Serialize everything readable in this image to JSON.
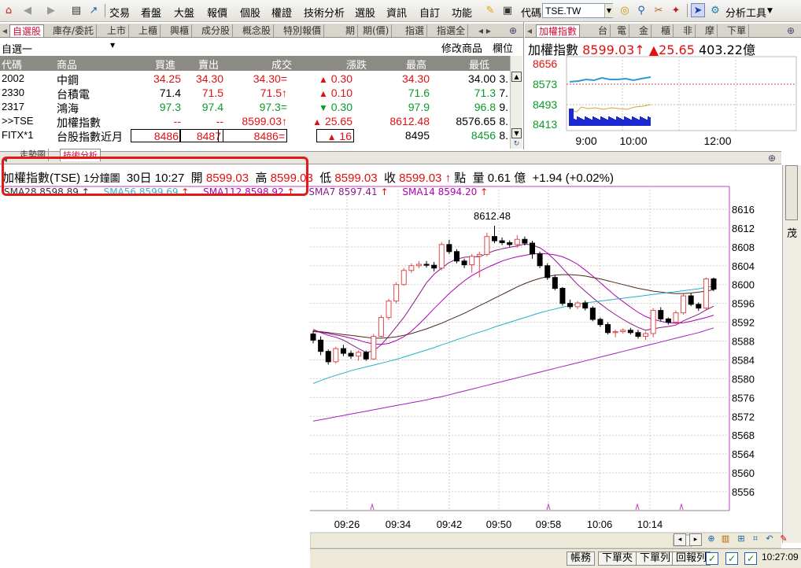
{
  "toolbar": {
    "menus": [
      "交易",
      "看盤",
      "大盤",
      "報價",
      "個股",
      "權證",
      "技術分析",
      "選股",
      "資訊",
      "自訂",
      "功能"
    ],
    "symbol_label": "代碼",
    "symbol_value": "TSE.TW",
    "analysis_tools": "分析工具"
  },
  "quote_panel": {
    "tabs": [
      "自選股",
      "庫存/委託",
      "上市",
      "上櫃",
      "興櫃",
      "成分股",
      "概念股",
      "特別報價",
      "期",
      "期(價)",
      "指選",
      "指選全"
    ],
    "list_name": "自選一",
    "modify_label": "修改商品",
    "field_label": "欄位",
    "headers": [
      "代碼",
      "商品",
      "買進",
      "賣出",
      "成交",
      "漲跌",
      "最高",
      "最低"
    ],
    "rows": [
      {
        "code": "2002",
        "name": "中鋼",
        "bid": "34.25",
        "ask": "34.30",
        "last": "34.30",
        "last_mark": "=",
        "chg_dir": "▲",
        "chg": "0.30",
        "high": "34.30",
        "low": "34.00",
        "tail": "3."
      },
      {
        "code": "2330",
        "name": "台積電",
        "bid": "71.4",
        "ask": "71.5",
        "last": "71.5",
        "last_mark": "↑",
        "chg_dir": "▲",
        "chg": "0.10",
        "high": "71.6",
        "low": "71.3",
        "tail": "7."
      },
      {
        "code": "2317",
        "name": "鴻海",
        "bid": "97.3",
        "ask": "97.4",
        "last": "97.3",
        "last_mark": "=",
        "chg_dir": "▼",
        "chg": "0.30",
        "high": "97.9",
        "low": "96.8",
        "tail": "9."
      },
      {
        "code": ">>TSE",
        "name": "加權指數",
        "bid": "--",
        "ask": "--",
        "last": "8599.03",
        "last_mark": "↑",
        "chg_dir": "▲",
        "chg": "25.65",
        "high": "8612.48",
        "low": "8576.65",
        "tail": "8."
      },
      {
        "code": "FITX*1",
        "name": "台股指數近月",
        "bid": "8486",
        "ask": "8487",
        "last": "8486",
        "last_mark": "=",
        "chg_dir": "▲",
        "chg": "16",
        "high": "8495",
        "low": "8456",
        "tail": "8."
      }
    ]
  },
  "mini_panel": {
    "tabs": [
      "加權指數",
      "台",
      "電",
      "金",
      "櫃",
      "非",
      "摩",
      "下單"
    ],
    "name": "加權指數",
    "price": "8599.03",
    "price_mark": "↑",
    "change": "▲25.65",
    "volume": "403.22億",
    "y_ticks": [
      "8656",
      "8573",
      "8493",
      "8413"
    ],
    "x_ticks": [
      "9:00",
      "10:00",
      "12:00"
    ]
  },
  "chart_panel": {
    "tabs": [
      "走勢圖",
      "技術分析"
    ],
    "info": {
      "name": "加權指數(TSE)",
      "period": "1分鐘圖",
      "date": "30日",
      "time": "10:27",
      "open_label": "開",
      "open": "8599.03",
      "high_label": "高",
      "high": "8599.03",
      "low_label": "低",
      "low": "8599.03",
      "close_label": "收",
      "close": "8599.03",
      "close_mark": "↑",
      "pts_label": "點",
      "vol_label": "量",
      "vol": "0.61",
      "vol_unit": "億",
      "change": "+1.94",
      "change_pct": "(+0.02%)"
    },
    "ma_labels": [
      "SMA28 8598.89",
      "SMA56 8599.69",
      "SMA112 8598.92",
      "SMA7 8597.41",
      "SMA14 8594.20"
    ],
    "right_strip_label": "茂"
  },
  "chart_data": {
    "type": "candlestick",
    "ylim": [
      8552,
      8620
    ],
    "y_ticks": [
      8556,
      8560,
      8564,
      8568,
      8572,
      8576,
      8580,
      8584,
      8588,
      8592,
      8596,
      8600,
      8604,
      8608,
      8612,
      8616
    ],
    "x_ticks": [
      "09:26",
      "09:34",
      "09:42",
      "09:50",
      "09:58",
      "10:06",
      "10:14"
    ],
    "annotation": "8612.48",
    "colors": {
      "up": "#e04a4a",
      "down": "#000000",
      "sma7": "#8b1a8b",
      "sma14": "#b000b0",
      "sma28": "#4a2a1a",
      "sma56": "#20b0d0",
      "sma112": "#a020c0"
    },
    "candles": [
      [
        8589.5,
        8590.2,
        8587.5,
        8588.2
      ],
      [
        8588.2,
        8589.0,
        8585.0,
        8585.8
      ],
      [
        8585.8,
        8586.2,
        8583.0,
        8583.6
      ],
      [
        8583.6,
        8586.8,
        8583.2,
        8586.4
      ],
      [
        8586.4,
        8587.2,
        8584.8,
        8585.4
      ],
      [
        8585.4,
        8586.0,
        8584.2,
        8584.8
      ],
      [
        8584.8,
        8586.0,
        8583.8,
        8585.6
      ],
      [
        8585.6,
        8586.0,
        8583.8,
        8584.2
      ],
      [
        8584.2,
        8589.5,
        8584.0,
        8589.0
      ],
      [
        8589.0,
        8593.5,
        8588.8,
        8593.0
      ],
      [
        8593.0,
        8597.0,
        8592.5,
        8596.5
      ],
      [
        8596.5,
        8600.5,
        8596.0,
        8600.0
      ],
      [
        8600.0,
        8603.5,
        8599.8,
        8603.0
      ],
      [
        8603.0,
        8604.5,
        8602.5,
        8604.0
      ],
      [
        8604.0,
        8605.0,
        8603.5,
        8604.3
      ],
      [
        8604.3,
        8605.0,
        8603.6,
        8604.1
      ],
      [
        8604.1,
        8604.8,
        8602.8,
        8603.5
      ],
      [
        8603.5,
        8609.0,
        8603.0,
        8608.5
      ],
      [
        8608.5,
        8609.5,
        8606.5,
        8607.0
      ],
      [
        8607.0,
        8607.5,
        8604.5,
        8605.0
      ],
      [
        8605.0,
        8605.5,
        8603.5,
        8604.2
      ],
      [
        8604.2,
        8606.5,
        8602.5,
        8606.0
      ],
      [
        8606.0,
        8607.0,
        8601.5,
        8606.4
      ],
      [
        8606.4,
        8611.0,
        8606.0,
        8610.2
      ],
      [
        8610.2,
        8612.48,
        8608.8,
        8609.3
      ],
      [
        8609.3,
        8610.0,
        8608.4,
        8608.9
      ],
      [
        8608.9,
        8609.4,
        8608.0,
        8608.5
      ],
      [
        8608.5,
        8610.5,
        8607.8,
        8609.6
      ],
      [
        8609.6,
        8610.2,
        8608.3,
        8608.8
      ],
      [
        8608.8,
        8609.3,
        8605.5,
        8606.5
      ],
      [
        8606.5,
        8607.0,
        8603.5,
        8604.0
      ],
      [
        8604.0,
        8604.5,
        8601.0,
        8601.5
      ],
      [
        8601.5,
        8602.0,
        8598.8,
        8599.2
      ],
      [
        8599.2,
        8599.5,
        8595.5,
        8596.0
      ],
      [
        8596.0,
        8596.8,
        8594.8,
        8595.3
      ],
      [
        8595.3,
        8596.5,
        8594.8,
        8596.1
      ],
      [
        8596.1,
        8596.6,
        8594.5,
        8595.0
      ],
      [
        8595.0,
        8595.4,
        8592.2,
        8592.6
      ],
      [
        8592.6,
        8593.0,
        8591.0,
        8591.5
      ],
      [
        8591.5,
        8592.0,
        8589.4,
        8589.8
      ],
      [
        8589.8,
        8590.4,
        8588.8,
        8590.0
      ],
      [
        8590.0,
        8590.7,
        8589.6,
        8590.3
      ],
      [
        8590.3,
        8590.8,
        8589.4,
        8589.8
      ],
      [
        8589.8,
        8590.4,
        8588.5,
        8589.0
      ],
      [
        8589.0,
        8590.0,
        8588.2,
        8589.6
      ],
      [
        8589.6,
        8595.0,
        8588.8,
        8594.5
      ],
      [
        8594.5,
        8595.2,
        8592.2,
        8592.7
      ],
      [
        8592.7,
        8593.0,
        8591.5,
        8592.0
      ],
      [
        8592.0,
        8594.5,
        8591.6,
        8594.0
      ],
      [
        8594.0,
        8598.0,
        8593.6,
        8597.6
      ],
      [
        8597.6,
        8598.2,
        8595.4,
        8595.8
      ],
      [
        8595.8,
        8596.2,
        8594.4,
        8595.0
      ],
      [
        8595.0,
        8601.5,
        8594.6,
        8601.2
      ],
      [
        8601.2,
        8601.5,
        8598.6,
        8599.03
      ]
    ],
    "series": [
      {
        "name": "SMA7",
        "values": [
          8590.5,
          8589.8,
          8589.2,
          8588.8,
          8588.2,
          8587.3,
          8586.4,
          8585.6,
          8585.9,
          8587.2,
          8589.0,
          8591.0,
          8593.0,
          8595.4,
          8597.9,
          8600.4,
          8602.2,
          8603.5,
          8604.7,
          8605.4,
          8605.8,
          8605.9,
          8605.9,
          8606.6,
          8607.2,
          8607.6,
          8607.9,
          8608.2,
          8608.6,
          8608.4,
          8607.8,
          8606.7,
          8605.2,
          8603.5,
          8601.7,
          8600.0,
          8598.6,
          8597.2,
          8595.9,
          8594.7,
          8593.6,
          8592.6,
          8591.7,
          8590.9,
          8590.3,
          8590.6,
          8590.9,
          8591.1,
          8591.4,
          8592.3,
          8593.0,
          8593.7,
          8594.6,
          8595.4
        ]
      },
      {
        "name": "SMA14",
        "values": [
          8590.0,
          8589.9,
          8589.6,
          8589.3,
          8589.0,
          8588.6,
          8588.2,
          8587.7,
          8587.4,
          8587.3,
          8587.5,
          8588.1,
          8588.9,
          8590.1,
          8591.6,
          8593.2,
          8594.9,
          8596.5,
          8598.1,
          8599.5,
          8600.8,
          8601.9,
          8602.8,
          8603.6,
          8604.3,
          8605.0,
          8605.5,
          8605.9,
          8606.2,
          8606.5,
          8606.6,
          8606.5,
          8606.3,
          8605.9,
          8605.2,
          8604.3,
          8603.1,
          8601.8,
          8600.4,
          8599.0,
          8597.6,
          8596.4,
          8595.2,
          8594.1,
          8593.2,
          8592.6,
          8592.2,
          8591.9,
          8591.8,
          8591.9,
          8592.2,
          8592.6,
          8593.0,
          8593.5
        ]
      },
      {
        "name": "SMA28",
        "values": [
          8590.2,
          8590.0,
          8589.8,
          8589.6,
          8589.4,
          8589.2,
          8589.0,
          8588.8,
          8588.6,
          8588.6,
          8588.7,
          8588.9,
          8589.2,
          8589.6,
          8590.1,
          8590.6,
          8591.2,
          8591.8,
          8592.5,
          8593.2,
          8593.9,
          8594.7,
          8595.5,
          8596.3,
          8597.1,
          8597.9,
          8598.7,
          8599.5,
          8600.2,
          8600.8,
          8601.3,
          8601.7,
          8602.0,
          8602.1,
          8602.1,
          8602.0,
          8601.8,
          8601.5,
          8601.2,
          8600.8,
          8600.4,
          8600.0,
          8599.6,
          8599.2,
          8598.9,
          8598.6,
          8598.4,
          8598.2,
          8598.1,
          8598.1,
          8598.2,
          8598.4,
          8598.6,
          8598.89
        ]
      },
      {
        "name": "SMA56",
        "values": [
          8579.0,
          8579.6,
          8580.2,
          8580.7,
          8581.2,
          8581.7,
          8582.1,
          8582.5,
          8582.9,
          8583.3,
          8583.7,
          8584.1,
          8584.6,
          8585.1,
          8585.6,
          8586.1,
          8586.6,
          8587.2,
          8587.7,
          8588.3,
          8588.8,
          8589.4,
          8589.9,
          8590.4,
          8591.0,
          8591.5,
          8592.0,
          8592.5,
          8593.0,
          8593.5,
          8594.0,
          8594.4,
          8594.8,
          8595.2,
          8595.5,
          8595.8,
          8596.1,
          8596.3,
          8596.5,
          8596.7,
          8596.9,
          8597.1,
          8597.3,
          8597.5,
          8597.7,
          8597.9,
          8598.1,
          8598.3,
          8598.5,
          8598.7,
          8598.9,
          8599.1,
          8599.4,
          8599.69
        ]
      },
      {
        "name": "SMA112",
        "values": [
          8571.0,
          8571.3,
          8571.6,
          8571.9,
          8572.2,
          8572.5,
          8572.8,
          8573.1,
          8573.4,
          8573.7,
          8574.0,
          8574.3,
          8574.6,
          8574.9,
          8575.2,
          8575.5,
          8575.9,
          8576.2,
          8576.6,
          8577.0,
          8577.4,
          8577.8,
          8578.2,
          8578.6,
          8579.0,
          8579.4,
          8579.8,
          8580.2,
          8580.6,
          8581.0,
          8581.4,
          8581.8,
          8582.2,
          8582.6,
          8583.0,
          8583.4,
          8583.8,
          8584.2,
          8584.6,
          8585.0,
          8585.4,
          8585.8,
          8586.2,
          8586.6,
          8587.0,
          8587.4,
          8587.8,
          8588.2,
          8588.6,
          8589.0,
          8589.4,
          8589.8,
          8590.3,
          8590.8
        ]
      }
    ]
  },
  "statusbar": {
    "buttons": [
      "帳務",
      "下單夾",
      "下單列",
      "回報列"
    ],
    "clock": "10:27:09"
  }
}
